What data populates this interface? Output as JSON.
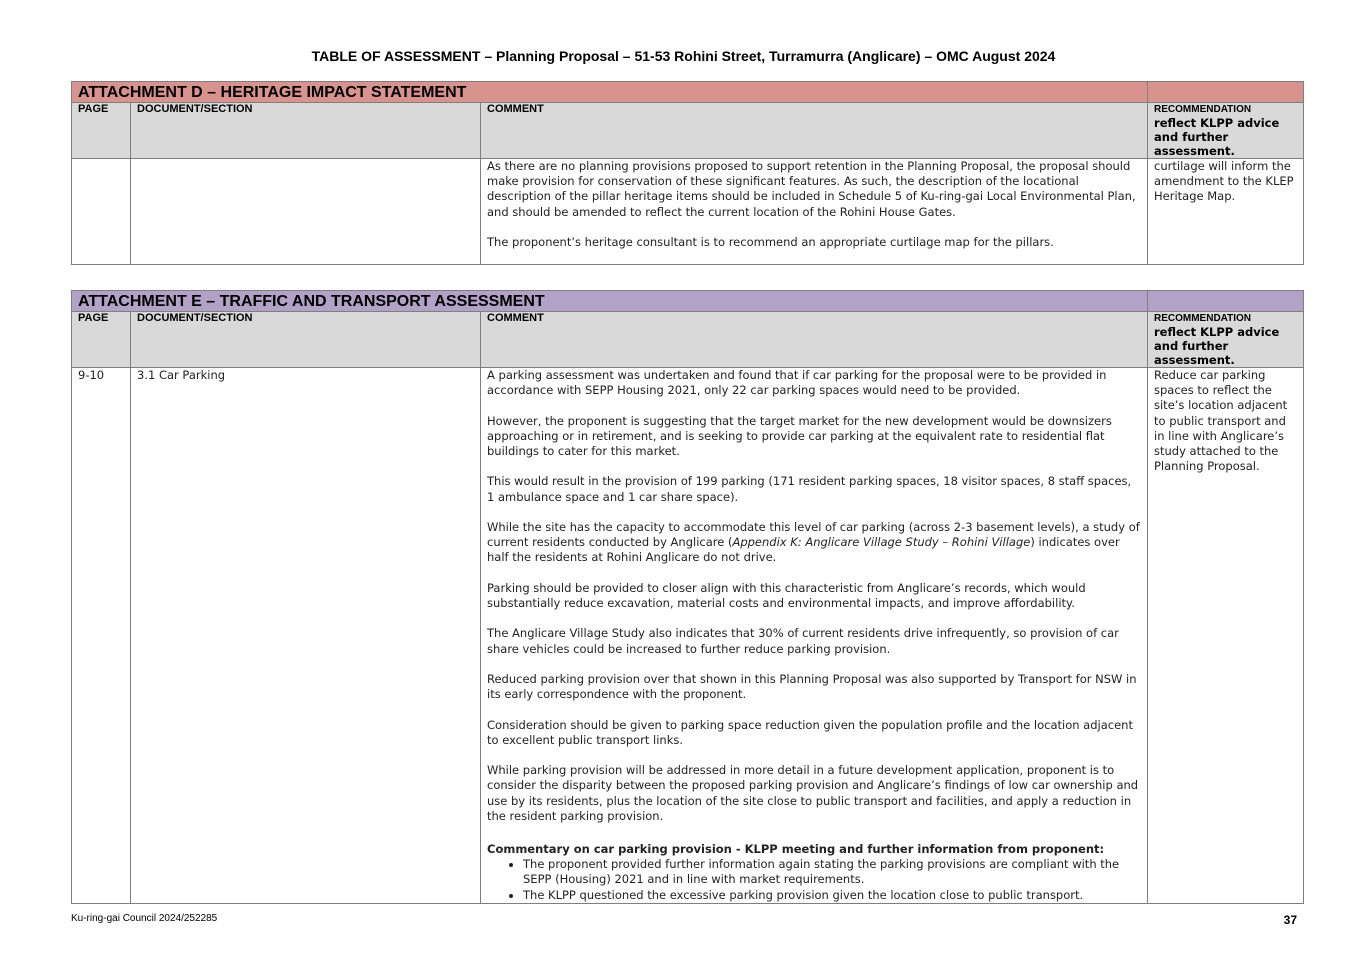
{
  "page_title": "TABLE OF ASSESSMENT – Planning Proposal – 51-53 Rohini Street, Turramurra (Anglicare) – OMC August 2024",
  "columns": {
    "page": "PAGE",
    "section": "DOCUMENT/SECTION",
    "comment": "COMMENT",
    "rec_small": "RECOMMENDATION",
    "rec_big": "reflect KLPP advice and further assessment."
  },
  "attachment_d": {
    "title": "ATTACHMENT D – HERITAGE IMPACT STATEMENT",
    "header_color": "#d9938f",
    "row": {
      "page": "",
      "section": "",
      "comment": [
        "As there are no planning provisions proposed to support retention in the Planning Proposal, the proposal should make provision for conservation of these significant features.  As such, the description of the locational description of the pillar heritage items should be included in Schedule 5 of Ku-ring-gai Local Environmental Plan, and should be amended to reflect the current location of the Rohini House Gates.",
        "The proponent’s heritage consultant is to recommend an appropriate curtilage map for the pillars."
      ],
      "recommendation": "curtilage will inform the amendment to the KLEP Heritage Map."
    }
  },
  "attachment_e": {
    "title": "ATTACHMENT E – TRAFFIC AND TRANSPORT ASSESSMENT",
    "header_color": "#b3a2c7",
    "row": {
      "page": "9-10",
      "section": "3.1 Car Parking",
      "comment": [
        "A parking assessment was undertaken and found that if car parking for the proposal were to be provided in accordance with SEPP Housing 2021, only 22 car parking spaces would need to be provided.",
        "However, the proponent is suggesting that the target market for the new development would be downsizers approaching or in retirement, and is seeking to provide car parking at the equivalent rate to residential flat buildings to cater for this market.",
        "This would result in the provision of 199 parking (171 resident parking spaces, 18 visitor spaces, 8 staff spaces, 1 ambulance space and 1 car share space).",
        "",
        "Parking should be provided to closer align with this characteristic from Anglicare’s records, which would substantially reduce excavation, material costs and environmental impacts, and improve affordability.",
        "The Anglicare Village Study also indicates that 30% of current residents drive infrequently, so provision of car share vehicles could be increased to further reduce parking provision.",
        "Reduced parking provision over that shown in this Planning Proposal was also supported by Transport for NSW in its early correspondence with the proponent.",
        "Consideration should be given to parking space reduction given the population profile and the location adjacent to excellent public transport links.",
        "While parking provision will be addressed in more detail in a future development application, proponent is to consider the disparity between the proposed parking provision and Anglicare’s findings of low car ownership and use by its residents, plus the location of the site close to public transport and facilities, and apply a reduction in the resident parking provision."
      ],
      "comment_4a": "While the site has the capacity to accommodate this level of car parking (across 2-3 basement levels), a study of current residents conducted by Anglicare (",
      "comment_4b": "Appendix K: Anglicare Village Study – Rohini Village",
      "comment_4c": ") indicates over half the residents at Rohini Anglicare do not drive.",
      "commentary_heading": "Commentary on car parking provision - KLPP meeting and further information from proponent:",
      "bullets": [
        "The proponent provided further information again stating the parking provisions are compliant with the SEPP (Housing) 2021 and in line with market requirements.",
        "The KLPP questioned the excessive parking provision given the location close to public transport."
      ],
      "recommendation": "Reduce car parking spaces to reflect the site’s location adjacent to public transport and in line with Anglicare’s study attached to the Planning Proposal."
    }
  },
  "footer": {
    "left": "Ku-ring-gai Council 2024/252285",
    "page_number": "37"
  }
}
